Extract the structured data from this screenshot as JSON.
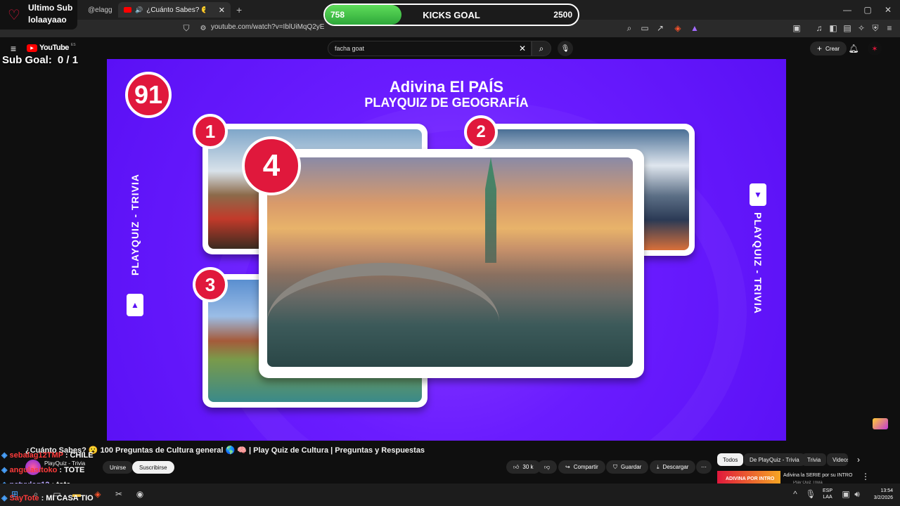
{
  "browser": {
    "tabs": [
      {
        "label": "@elagg",
        "active": false
      },
      {
        "label": "¿Cuánto Sabes? 😮 100 Preg",
        "active": true
      }
    ],
    "new_tab": "+",
    "url": "youtube.com/watch?v=IblUiMqQ2yE",
    "window_controls": [
      "minimize",
      "maximize",
      "close"
    ]
  },
  "youtube": {
    "logo": "YouTube",
    "country": "ES",
    "search_value": "facha goat",
    "create_label": "Crear",
    "video": {
      "score_badge": "91",
      "title_line1": "Adivina El PAÍS",
      "title_line2": "PLAYQUIZ DE GEOGRAFÍA",
      "side_label_left": "PLAYQUIZ - TRIVIA",
      "side_label_right": "PLAYQUIZ - TRIVIA",
      "cards": [
        "1",
        "2",
        "3",
        "4"
      ]
    },
    "video_title": "¿Cuánto Sabes? 😮 100 Preguntas de Cultura general 🌎 🧠 | Play Quiz de Cultura | Preguntas y Respuestas",
    "channel": {
      "name": "PlayQuiz - Trivia",
      "join": "Unirse",
      "subscribe": "Suscribirse"
    },
    "actions": {
      "likes": "30 k",
      "share": "Compartir",
      "save": "Guardar",
      "download": "Descargar"
    },
    "chips": [
      "Todos",
      "De PlayQuiz - Trivia",
      "Trivia",
      "Videos"
    ],
    "related": {
      "thumb_text": "ADIVINA POR INTRO",
      "title": "Adivina la SERIE por su INTRO",
      "channel": "Play Quiz Trivia"
    }
  },
  "overlay": {
    "sub_banner_line1": "Ultimo Sub",
    "sub_banner_line2": "lolaayaao",
    "sub_goal_label": "Sub Goal:",
    "sub_goal_value": "0 / 1",
    "kicks_current": "758",
    "kicks_label": "KICKS GOAL",
    "kicks_target": "2500",
    "kicks_progress": 0.303,
    "chat": [
      {
        "user": "sebalag12TMP",
        "message": "CHILE"
      },
      {
        "user": "angulasitoko",
        "message": "TOTE"
      },
      {
        "user": "patyylag12",
        "message": "tote"
      },
      {
        "user": "SayTote",
        "message": "MI CASA TIO"
      }
    ]
  },
  "taskbar": {
    "lang_line1": "ESP",
    "lang_line2": "LAA",
    "time": "13:54",
    "date": "3/2/2026"
  },
  "colors": {
    "video_bg": "#6a1cff",
    "badge_red": "#e0183c",
    "goal_green": "#3cc24a"
  }
}
